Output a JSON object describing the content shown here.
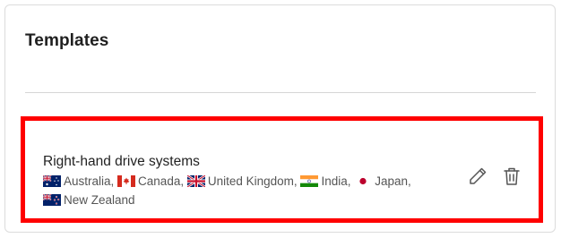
{
  "card": {
    "title": "Templates"
  },
  "template": {
    "name": "Right-hand drive systems",
    "countries": [
      {
        "flag": "australia-flag-icon",
        "label": "Australia,"
      },
      {
        "flag": "canada-flag-icon",
        "label": "Canada,"
      },
      {
        "flag": "united-kingdom-flag-icon",
        "label": "United Kingdom,"
      },
      {
        "flag": "india-flag-icon",
        "label": "India,"
      },
      {
        "flag": "japan-flag-icon",
        "label": "Japan,"
      },
      {
        "flag": "new-zealand-flag-icon",
        "label": "New Zealand"
      }
    ],
    "actions": [
      "pencil-icon",
      "trash-icon"
    ],
    "highlight_color": "#ff0000"
  }
}
